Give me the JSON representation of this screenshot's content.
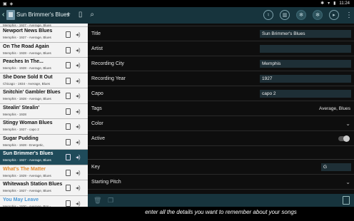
{
  "statusbar": {
    "time": "11:24"
  },
  "actionbar": {
    "title": "Sun Brimmer's Blues",
    "back": "‹",
    "add": "+",
    "more": "⋮"
  },
  "songs": [
    {
      "title": "",
      "sub": "Memphis - 1927 - Average, Blues",
      "state": "first"
    },
    {
      "title": "Newport News Blues",
      "sub": "Memphis - 1927 - Average, Blues",
      "state": ""
    },
    {
      "title": "On The Road Again",
      "sub": "Memphis - 1928 - Average, Blues",
      "state": ""
    },
    {
      "title": "Peaches In The...",
      "sub": "Memphis - 1928 - Average, Blues",
      "state": ""
    },
    {
      "title": "She Done Sold It Out",
      "sub": "Chicago - 1934 - Average, Blues",
      "state": ""
    },
    {
      "title": "Snitchin' Gambler Blues",
      "sub": "Memphis - 1928 - Average, Blues",
      "state": ""
    },
    {
      "title": "Stealin' Stealin'",
      "sub": "Memphis - 1928",
      "state": ""
    },
    {
      "title": "Stingy Woman Blues",
      "sub": "Memphis - 1927 - capo 2",
      "state": ""
    },
    {
      "title": "Sugar Pudding",
      "sub": "Memphis - 1928 - Energetic,",
      "state": ""
    },
    {
      "title": "Sun Brimmer's Blues",
      "sub": "Memphis - 1927 - Average, Blues",
      "state": "selected"
    },
    {
      "title": "What's The Matter",
      "sub": "Memphis - 1929 - Average, Blues",
      "state": "orange"
    },
    {
      "title": "Whitewash Station Blues",
      "sub": "Memphis - 1927 - Average, Blues",
      "state": ""
    },
    {
      "title": "You May Leave",
      "sub": "Memphis - 1930 - Average, Pop -",
      "state": "blue"
    }
  ],
  "detail": {
    "title_label": "Title",
    "title_value": "Sun Brimmer's Blues",
    "artist_label": "Artist",
    "artist_value": "",
    "city_label": "Recording City",
    "city_value": "Memphis",
    "year_label": "Recording Year",
    "year_value": "1927",
    "capo_label": "Capo",
    "capo_value": "capo 2",
    "tags_label": "Tags",
    "tags_value": "Average, Blues",
    "color_label": "Color",
    "active_label": "Active",
    "key_label": "Key",
    "key_value": "G",
    "pitch_label": "Starting Pitch"
  },
  "caption": "enter all the details you want to remember about your songs"
}
